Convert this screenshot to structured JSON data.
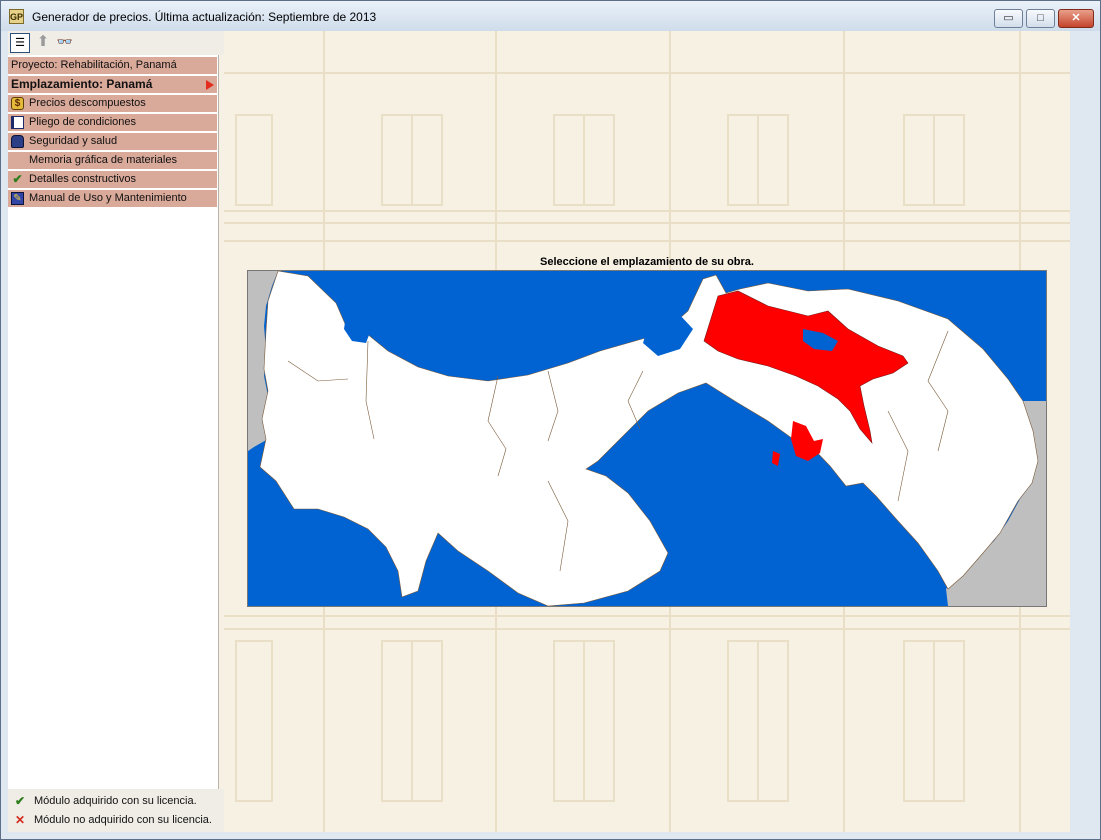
{
  "window": {
    "title": "Generador de precios. Última actualización: Septiembre de 2013",
    "app_icon_text": "GP",
    "min_glyph": "▭",
    "max_glyph": "□",
    "close_glyph": "✕"
  },
  "toolbar": {
    "list_glyph": "☰",
    "up_glyph": "⬆",
    "search_glyph": "👓"
  },
  "sidebar": {
    "project": "Proyecto: Rehabilitación, Panamá",
    "location": "Emplazamiento: Panamá",
    "items": [
      {
        "label": "Precios descompuestos",
        "icon": "coin-icon",
        "glyph": "$"
      },
      {
        "label": "Pliego de condiciones",
        "icon": "document-icon",
        "glyph": ""
      },
      {
        "label": "Seguridad y salud",
        "icon": "helmet-icon",
        "glyph": ""
      },
      {
        "label": "Memoria gráfica de materiales",
        "icon": "",
        "glyph": ""
      },
      {
        "label": "Detalles constructivos",
        "icon": "check-icon",
        "glyph": "✔"
      },
      {
        "label": "Manual de Uso y Mantenimiento",
        "icon": "manual-icon",
        "glyph": "✎"
      }
    ]
  },
  "legend": {
    "acquired": {
      "symbol": "✔",
      "text": "Módulo adquirido con su licencia.",
      "color": "#2d7d1d"
    },
    "not_acquired": {
      "symbol": "✕",
      "text": "Módulo no adquirido con su licencia.",
      "color": "#d42a1e"
    }
  },
  "content": {
    "help_glyph": "?",
    "map_title": "Seleccione el emplazamiento de su obra.",
    "colors": {
      "sea": "#0063d1",
      "land": "#ffffff",
      "selected": "#ff0000",
      "neighbor": "#bfbfbf"
    }
  }
}
